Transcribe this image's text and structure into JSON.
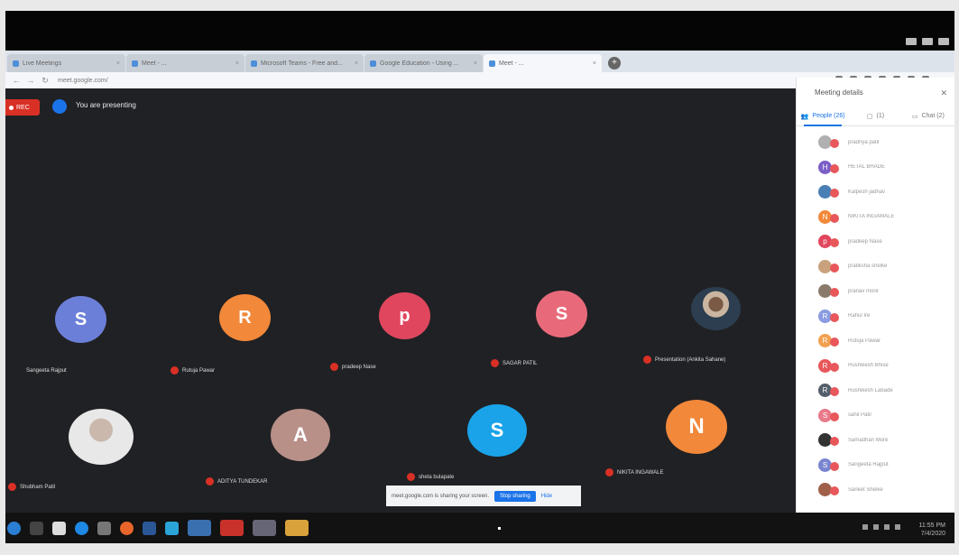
{
  "browser": {
    "tabs": [
      {
        "label": "Live Meetings"
      },
      {
        "label": "Meet - ..."
      },
      {
        "label": "Microsoft Teams - Free and..."
      },
      {
        "label": "Google Education - Using ..."
      },
      {
        "label": "Meet - ..."
      }
    ],
    "new_tab_glyph": "+",
    "url": "meet.google.com/"
  },
  "meeting": {
    "rec_label": "REC",
    "presenting_text": "You are presenting",
    "tiles": [
      {
        "initial": "S",
        "color": "#6c7fd8",
        "name": "Sangeeta Rajput"
      },
      {
        "initial": "R",
        "color": "#f2883a",
        "name": "Rutuja Pawar"
      },
      {
        "initial": "p",
        "color": "#e0475e",
        "name": "pradeep Nase"
      },
      {
        "initial": "S",
        "color": "#e86a7a",
        "name": "SAGAR PATIL"
      },
      {
        "initial": "",
        "color": "",
        "name": "Presentation (Ankita Sahane)"
      },
      {
        "initial": "",
        "color": "",
        "name": "Shubham Patil"
      },
      {
        "initial": "A",
        "color": "#b89088",
        "name": "ADITYA TUNDEKAR"
      },
      {
        "initial": "S",
        "color": "#1aa3e8",
        "name": "sheta bulapate"
      },
      {
        "initial": "N",
        "color": "#f2883a",
        "name": "NIKITA INGAWALE"
      }
    ],
    "share_bar": {
      "text": "meet.google.com is sharing your screen.",
      "stop_label": "Stop sharing",
      "hide_label": "Hide"
    }
  },
  "panel": {
    "title": "Meeting details",
    "close_glyph": "✕",
    "tabs": [
      {
        "label": "People (26)"
      },
      {
        "label": "(1)"
      },
      {
        "label": "Chat (2)"
      }
    ],
    "people": [
      {
        "initial": "",
        "color": "#b0b0b0",
        "name": "pradnya patil"
      },
      {
        "initial": "H",
        "color": "#7b5fc6",
        "name": "HETAL BHADE"
      },
      {
        "initial": "",
        "color": "#4a7fb5",
        "name": "Kalpesh jadhav"
      },
      {
        "initial": "N",
        "color": "#f2883a",
        "name": "NIKITA INGAWALE"
      },
      {
        "initial": "p",
        "color": "#e0475e",
        "name": "pradeep Nase"
      },
      {
        "initial": "",
        "color": "#c9a27d",
        "name": "pratiksha shelke"
      },
      {
        "initial": "",
        "color": "#8a7a6a",
        "name": "pranav more"
      },
      {
        "initial": "R",
        "color": "#8a9be0",
        "name": "Rahul Ire"
      },
      {
        "initial": "R",
        "color": "#f2a050",
        "name": "Rutuja Pawar"
      },
      {
        "initial": "R",
        "color": "#e8575a",
        "name": "Rushikesh Bhise"
      },
      {
        "initial": "R",
        "color": "#555f6b",
        "name": "Rushikesh Labade"
      },
      {
        "initial": "S",
        "color": "#e87a8a",
        "name": "sahil Patil"
      },
      {
        "initial": "",
        "color": "#333333",
        "name": "Samadhan More"
      },
      {
        "initial": "S",
        "color": "#7a85d0",
        "name": "Sangeeta Rajput"
      },
      {
        "initial": "",
        "color": "#a0604a",
        "name": "Sanket Shelke"
      }
    ]
  },
  "taskbar": {
    "clock_time": "11:55 PM",
    "clock_date": "7/4/2020"
  }
}
